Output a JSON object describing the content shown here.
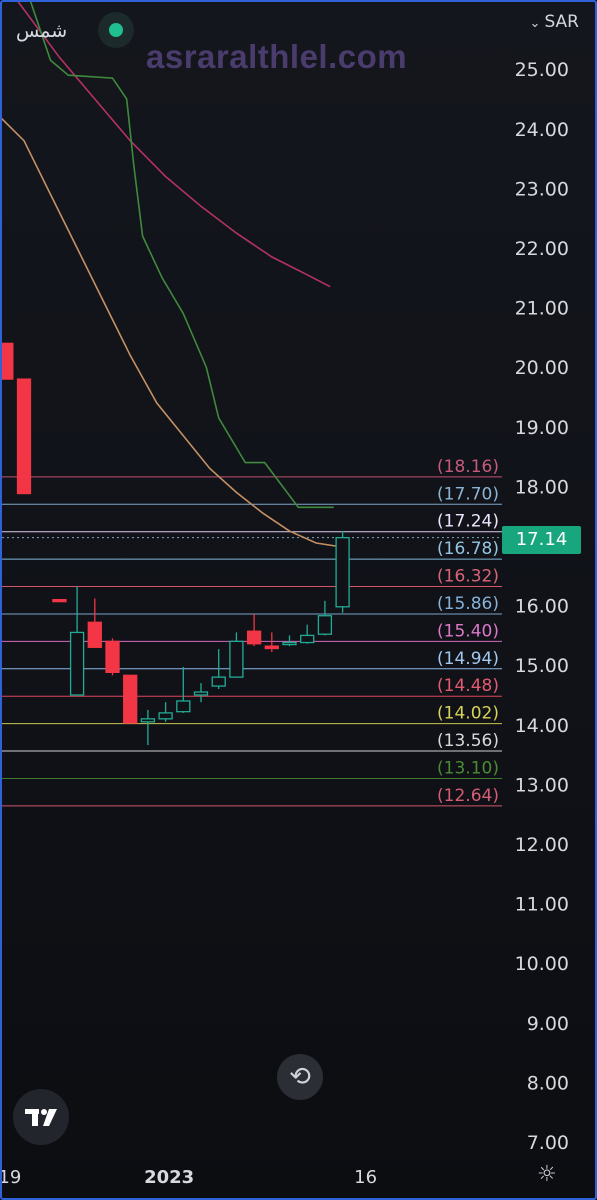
{
  "header": {
    "symbol": "شمس",
    "watermark": "asraralthlel.com",
    "currency_label": "SAR"
  },
  "price_scale": {
    "last_price": "17.14"
  },
  "colors": {
    "up": "#22ab94",
    "down": "#f23645",
    "accent_green": "#1fbf92",
    "border": "#2f62d8"
  },
  "icons": {
    "currency_dropdown": "chevron-down-icon",
    "reset": "rotate-ccw-icon",
    "logo": "tradingview-logo",
    "settings": "gear-icon"
  },
  "chart_data": {
    "type": "candlestick",
    "y_range": [
      6.8,
      26.2
    ],
    "y_ticks": [
      "25.00",
      "24.00",
      "23.00",
      "22.00",
      "21.00",
      "20.00",
      "19.00",
      "18.00",
      "16.00",
      "15.00",
      "14.00",
      "13.00",
      "12.00",
      "11.00",
      "10.00",
      "9.00",
      "8.00",
      "7.00"
    ],
    "x_ticks": [
      {
        "label": "19",
        "bar": -0.8,
        "bold": false
      },
      {
        "label": "2023",
        "bar": 8.2,
        "bold": true
      },
      {
        "label": "16",
        "bar": 19.3,
        "bold": false
      }
    ],
    "candles": [
      {
        "bar": -1,
        "open": 20.4,
        "high": 20.4,
        "low": 19.8,
        "close": 19.8
      },
      {
        "bar": 0,
        "open": 19.8,
        "high": 19.8,
        "low": 17.88,
        "close": 17.88
      },
      {
        "bar": 2,
        "open": 16.1,
        "high": 16.1,
        "low": 16.08,
        "close": 16.08
      },
      {
        "bar": 3,
        "open": 14.5,
        "high": 16.32,
        "low": 14.5,
        "close": 15.55
      },
      {
        "bar": 4,
        "open": 15.72,
        "high": 16.12,
        "low": 15.3,
        "close": 15.3
      },
      {
        "bar": 5,
        "open": 15.4,
        "high": 15.45,
        "low": 14.83,
        "close": 14.88
      },
      {
        "bar": 6,
        "open": 14.83,
        "high": 14.83,
        "low": 14.03,
        "close": 14.03
      },
      {
        "bar": 7,
        "open": 14.05,
        "high": 14.25,
        "low": 13.66,
        "close": 14.1
      },
      {
        "bar": 8,
        "open": 14.1,
        "high": 14.38,
        "low": 14.05,
        "close": 14.2
      },
      {
        "bar": 9,
        "open": 14.22,
        "high": 14.97,
        "low": 14.2,
        "close": 14.4
      },
      {
        "bar": 10,
        "open": 14.5,
        "high": 14.7,
        "low": 14.38,
        "close": 14.55
      },
      {
        "bar": 11,
        "open": 14.65,
        "high": 15.27,
        "low": 14.6,
        "close": 14.8
      },
      {
        "bar": 12,
        "open": 14.8,
        "high": 15.55,
        "low": 14.8,
        "close": 15.4
      },
      {
        "bar": 13,
        "open": 15.57,
        "high": 15.86,
        "low": 15.32,
        "close": 15.36
      },
      {
        "bar": 14,
        "open": 15.32,
        "high": 15.55,
        "low": 15.22,
        "close": 15.28
      },
      {
        "bar": 15,
        "open": 15.35,
        "high": 15.5,
        "low": 15.32,
        "close": 15.38
      },
      {
        "bar": 16,
        "open": 15.38,
        "high": 15.68,
        "low": 15.36,
        "close": 15.5
      },
      {
        "bar": 17,
        "open": 15.52,
        "high": 16.08,
        "low": 15.5,
        "close": 15.83
      },
      {
        "bar": 18,
        "open": 15.98,
        "high": 17.25,
        "low": 15.88,
        "close": 17.14
      }
    ],
    "levels": [
      {
        "value": 18.16,
        "label": "(18.16)",
        "color": "#c44f72",
        "text_color": "#c65a7b"
      },
      {
        "value": 17.7,
        "label": "(17.70)",
        "color": "#7fa6c6",
        "text_color": "#8db4d4"
      },
      {
        "value": 17.24,
        "label": "(17.24)",
        "color": "#dccbf0",
        "text_color": "#eee6ff"
      },
      {
        "value": 16.78,
        "label": "(16.78)",
        "color": "#7fb9d8",
        "text_color": "#94c6e2"
      },
      {
        "value": 16.32,
        "label": "(16.32)",
        "color": "#d2576a",
        "text_color": "#d76577"
      },
      {
        "value": 15.86,
        "label": "(15.86)",
        "color": "#77a4cc",
        "text_color": "#86b2d8"
      },
      {
        "value": 15.4,
        "label": "(15.40)",
        "color": "#d66ac0",
        "text_color": "#dc78c8"
      },
      {
        "value": 14.94,
        "label": "(14.94)",
        "color": "#8bb8e8",
        "text_color": "#a3c8f0"
      },
      {
        "value": 14.48,
        "label": "(14.48)",
        "color": "#e0445c",
        "text_color": "#e35a70"
      },
      {
        "value": 14.02,
        "label": "(14.02)",
        "color": "#c9c64e",
        "text_color": "#d8d35a"
      },
      {
        "value": 13.56,
        "label": "(13.56)",
        "color": "#d0d0d0",
        "text_color": "#d8d8d8"
      },
      {
        "value": 13.1,
        "label": "(13.10)",
        "color": "#3c7c2c",
        "text_color": "#4a8c34"
      },
      {
        "value": 12.64,
        "label": "(12.64)",
        "color": "#d2566b",
        "text_color": "#d65e73"
      }
    ],
    "moving_averages": [
      {
        "color": "#b43262",
        "points": [
          [
            -1.5,
            26.6
          ],
          [
            0,
            26
          ],
          [
            2,
            25.2
          ],
          [
            4,
            24.5
          ],
          [
            6,
            23.8
          ],
          [
            8,
            23.2
          ],
          [
            10,
            22.7
          ],
          [
            12,
            22.25
          ],
          [
            14,
            21.85
          ],
          [
            16,
            21.55
          ],
          [
            17.3,
            21.35
          ]
        ]
      },
      {
        "color": "#3f8a3c",
        "points": [
          [
            0.3,
            26.2
          ],
          [
            1.5,
            25.15
          ],
          [
            2.5,
            24.9
          ],
          [
            5,
            24.85
          ],
          [
            5.8,
            24.5
          ],
          [
            6.2,
            23.4
          ],
          [
            6.7,
            22.2
          ],
          [
            7.8,
            21.5
          ],
          [
            9,
            20.9
          ],
          [
            10.3,
            20.0
          ],
          [
            11,
            19.15
          ],
          [
            12.5,
            18.4
          ],
          [
            13.6,
            18.4
          ],
          [
            15.5,
            17.65
          ],
          [
            17.5,
            17.65
          ]
        ]
      },
      {
        "color": "#c49064",
        "points": [
          [
            -1.7,
            24.3
          ],
          [
            0,
            23.8
          ],
          [
            1.5,
            22.9
          ],
          [
            3,
            22.0
          ],
          [
            4.5,
            21.1
          ],
          [
            6,
            20.2
          ],
          [
            7.5,
            19.4
          ],
          [
            9,
            18.85
          ],
          [
            10.5,
            18.3
          ],
          [
            12,
            17.9
          ],
          [
            13.5,
            17.55
          ],
          [
            15,
            17.25
          ],
          [
            16.5,
            17.05
          ],
          [
            17.6,
            17.0
          ]
        ]
      }
    ]
  }
}
